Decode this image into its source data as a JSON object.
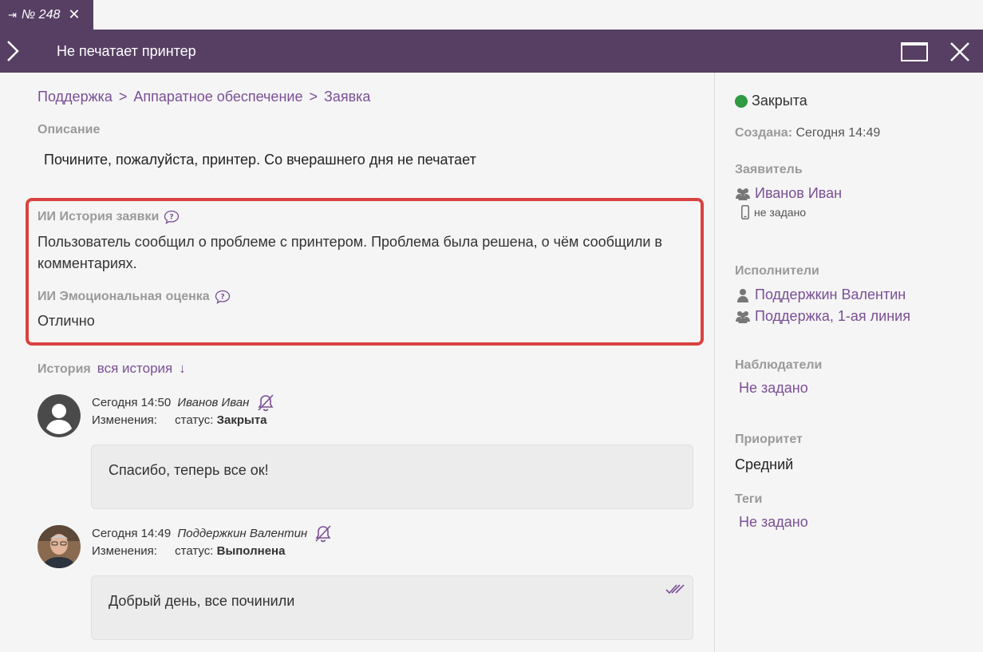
{
  "tab": {
    "pin_icon": "⇥",
    "number": "№ 248",
    "close_icon": "✕"
  },
  "titlebar": {
    "title": "Не печатает принтер"
  },
  "breadcrumb": {
    "items": [
      "Поддержка",
      "Аппаратное обеспечение",
      "Заявка"
    ],
    "sep1": ">",
    "sep2": ">"
  },
  "description": {
    "label": "Описание",
    "text": "Почините, пожалуйста, принтер. Со вчерашнего дня не печатает"
  },
  "ai": {
    "history_label": "ИИ История заявки",
    "history_text": "Пользователь сообщил о проблеме с принтером. Проблема была решена, о чём сообщили в комментариях.",
    "emotion_label": "ИИ Эмоциональная оценка",
    "emotion_text": "Отлично"
  },
  "history": {
    "label": "История",
    "all_link": "вся история",
    "arrow": "↓",
    "entries": [
      {
        "time": "Сегодня 14:50",
        "author": "Иванов Иван",
        "changes_label": "Изменения:",
        "change_key": "статус:",
        "change_value": "Закрыта",
        "message": "Спасибо, теперь все ок!"
      },
      {
        "time": "Сегодня 14:49",
        "author": "Поддержкин Валентин",
        "changes_label": "Изменения:",
        "change_key": "статус:",
        "change_value": "Выполнена",
        "message": "Добрый день, все починили"
      }
    ]
  },
  "sidebar": {
    "status": "Закрыта",
    "status_color": "#2f9a41",
    "created_label": "Создана:",
    "created_value": "Сегодня 14:49",
    "requester_label": "Заявитель",
    "requester_name": "Иванов Иван",
    "requester_phone": "не задано",
    "executors_label": "Исполнители",
    "executor_person": "Поддержкин Валентин",
    "executor_group": "Поддержка, 1-ая линия",
    "observers_label": "Наблюдатели",
    "observers_value": "Не задано",
    "priority_label": "Приоритет",
    "priority_value": "Средний",
    "tags_label": "Теги",
    "tags_value": "Не задано"
  },
  "colors": {
    "header": "#573f63",
    "accent": "#7a4f96",
    "highlight_border": "#d9433f"
  }
}
